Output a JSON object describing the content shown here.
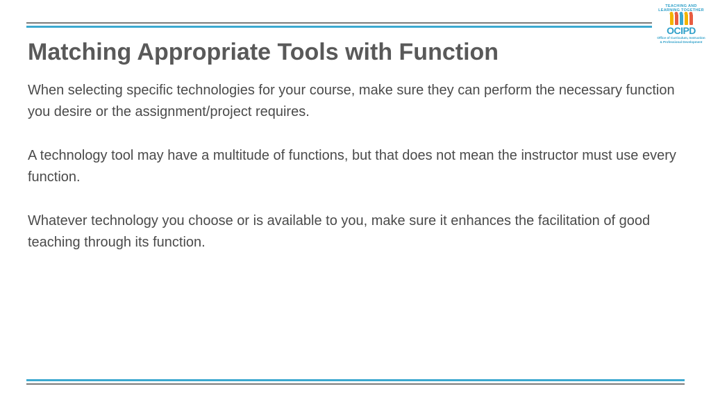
{
  "logo": {
    "arc_text": "TEACHING AND LEARNING TOGETHER",
    "name": "OCIPD",
    "sub1": "Office of Curriculum, Instruction",
    "sub2": "& Professional Development"
  },
  "title": "Matching Appropriate Tools with Function",
  "paragraphs": [
    "When selecting specific technologies for your course, make sure they can perform the necessary function you desire or the assignment/project requires.",
    "A technology tool may have a multitude of functions, but that does not mean the instructor must use every function.",
    "Whatever technology you choose or is available to you, make sure it enhances the facilitation of good teaching through its function."
  ]
}
